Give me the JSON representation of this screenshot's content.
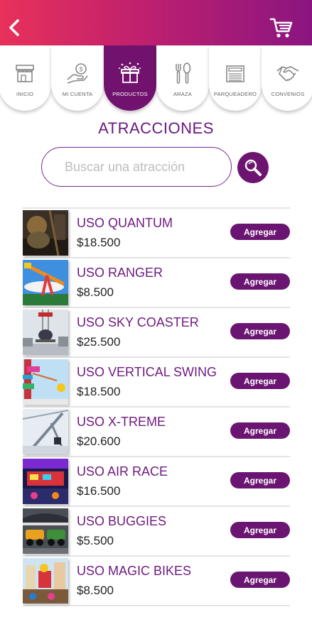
{
  "header": {
    "back_icon": "chevron-left-icon",
    "cart_icon": "cart-icon"
  },
  "tabs": [
    {
      "label": "INICIO",
      "icon": "store-icon",
      "active": false
    },
    {
      "label": "MI CUENTA",
      "icon": "hand-coin-icon",
      "active": false
    },
    {
      "label": "PRODUCTOS",
      "icon": "gift-box-icon",
      "active": true
    },
    {
      "label": "ARAZA",
      "icon": "fork-spoon-icon",
      "active": false
    },
    {
      "label": "PARQUEADERO",
      "icon": "parking-gate-icon",
      "active": false
    },
    {
      "label": "CONVENIOS",
      "icon": "handshake-icon",
      "active": false
    }
  ],
  "section": {
    "title": "ATRACCIONES"
  },
  "search": {
    "placeholder": "Buscar una atracción",
    "value": "",
    "icon": "search-icon"
  },
  "add_label": "Agregar",
  "items": [
    {
      "name": "USO QUANTUM",
      "price": "$18.500"
    },
    {
      "name": "USO RANGER",
      "price": "$8.500"
    },
    {
      "name": "USO SKY COASTER",
      "price": "$25.500"
    },
    {
      "name": "USO VERTICAL SWING",
      "price": "$18.500"
    },
    {
      "name": "USO X-TREME",
      "price": "$20.600"
    },
    {
      "name": "USO AIR RACE",
      "price": "$16.500"
    },
    {
      "name": "USO BUGGIES",
      "price": "$5.500"
    },
    {
      "name": "USO MAGIC BIKES",
      "price": "$8.500"
    }
  ],
  "colors": {
    "accent": "#6b1572",
    "header_start": "#e8315a",
    "header_end": "#8a1580"
  }
}
